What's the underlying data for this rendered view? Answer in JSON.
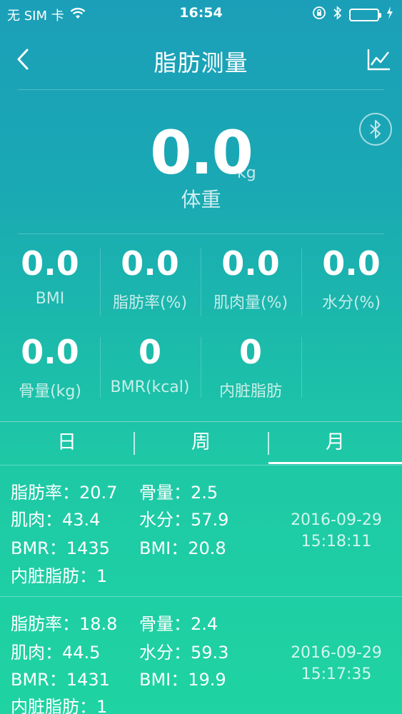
{
  "status_bar": {
    "carrier": "无 SIM 卡",
    "time": "16:54",
    "icons": [
      "wifi-icon",
      "rotation-lock-icon",
      "bluetooth-icon",
      "battery-icon",
      "charging-icon"
    ]
  },
  "nav": {
    "title": "脂肪测量",
    "back_icon": "chevron-left-icon",
    "chart_icon": "line-chart-icon"
  },
  "weight": {
    "value": "0.0",
    "unit": "kg",
    "label": "体重"
  },
  "metrics": [
    {
      "value": "0.0",
      "label": "BMI"
    },
    {
      "value": "0.0",
      "label": "脂肪率(%)"
    },
    {
      "value": "0.0",
      "label": "肌肉量(%)"
    },
    {
      "value": "0.0",
      "label": "水分(%)"
    },
    {
      "value": "0.0",
      "label": "骨量(kg)"
    },
    {
      "value": "0",
      "label": "BMR(kcal)"
    },
    {
      "value": "0",
      "label": "内脏脂肪"
    }
  ],
  "tabs": [
    {
      "label": "日"
    },
    {
      "label": "周"
    },
    {
      "label": "月",
      "active": true
    }
  ],
  "records": [
    {
      "fat": "脂肪率：20.7",
      "bone": "骨量：2.5",
      "muscle": "肌肉：43.4",
      "water": "水分：57.9",
      "bmr": "BMR：1435",
      "bmi": "BMI：20.8",
      "visceral": "内脏脂肪：1",
      "date": "2016-09-29",
      "time": "15:18:11"
    },
    {
      "fat": "脂肪率：18.8",
      "bone": "骨量：2.4",
      "muscle": "肌肉：44.5",
      "water": "水分：59.3",
      "bmr": "BMR：1431",
      "bmi": "BMI：19.9",
      "visceral": "内脏脂肪：1",
      "date": "2016-09-29",
      "time": "15:17:35"
    }
  ],
  "colors": {
    "gradient_top": "#1b9fb9",
    "gradient_bottom": "#1fd3a2",
    "text": "#ffffff"
  }
}
